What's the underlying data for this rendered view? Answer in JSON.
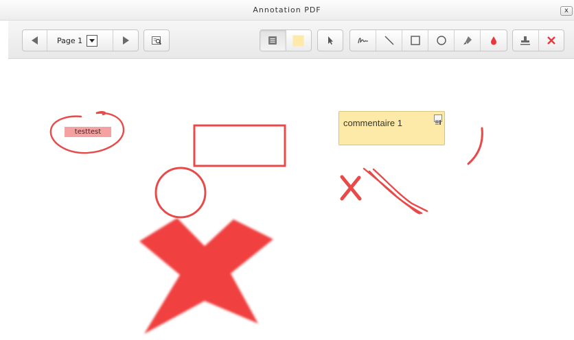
{
  "window": {
    "title": "Annotation PDF",
    "close_label": "x"
  },
  "toolbar": {
    "page_label": "Page 1",
    "icons": {
      "prev": "arrow-left-icon",
      "next": "arrow-right-icon",
      "search": "search-page-icon",
      "comment": "comment-icon",
      "color": "color-swatch-icon",
      "select": "pointer-icon",
      "pen": "pen-icon",
      "line": "line-icon",
      "rectangle": "rectangle-icon",
      "oval": "oval-icon",
      "highlighter": "highlighter-icon",
      "fill": "fill-color-icon",
      "stamp": "stamp-icon",
      "clear": "delete-icon"
    },
    "swatch_color": "#fde9a8",
    "accent_red": "#e8383d"
  },
  "annotations": {
    "highlight_text": "testtest",
    "comment_text": "commentaire 1",
    "annotation_color": "#e84a4a",
    "highlight_color": "#f3a1a1",
    "comment_bg": "#fde9a8"
  }
}
